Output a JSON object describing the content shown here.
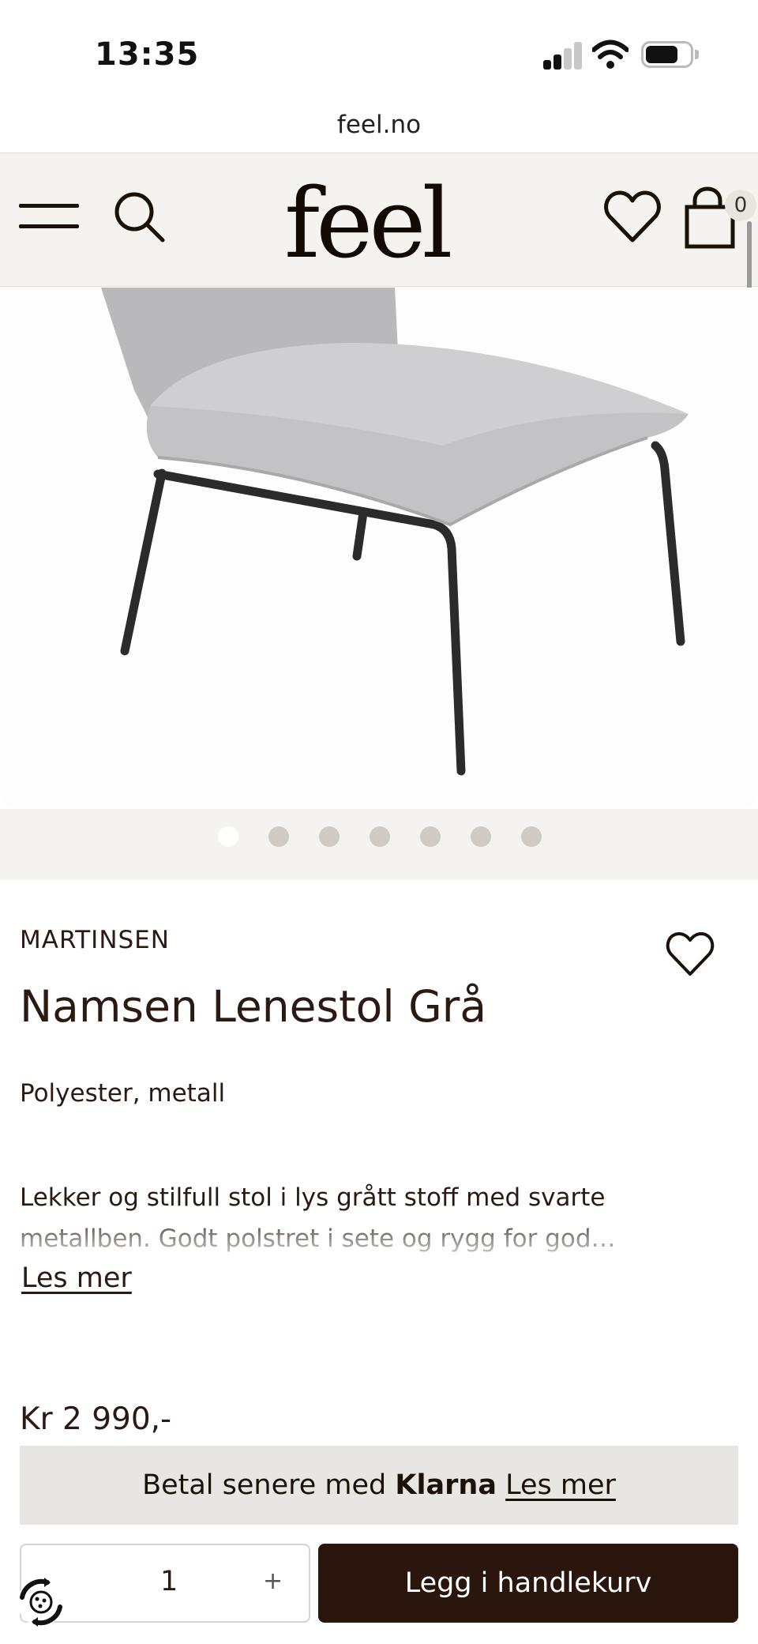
{
  "status_bar": {
    "time": "13:35"
  },
  "browser": {
    "url": "feel.no"
  },
  "header": {
    "logo": "feel",
    "cart_count": "0"
  },
  "carousel": {
    "total": 7,
    "active_index": 0
  },
  "product": {
    "brand": "MARTINSEN",
    "title": "Namsen Lenestol Grå",
    "material": "Polyester, metall",
    "description": "Lekker og stilfull stol i lys grått stoff med svarte metallben. Godt polstret i sete og rygg for god…",
    "read_more_label": "Les mer",
    "price": "Kr 2 990,-"
  },
  "klarna": {
    "text": "Betal senere med",
    "brand": "Klarna",
    "link_label": "Les mer"
  },
  "quantity": {
    "value": "1",
    "plus_label": "+"
  },
  "cart_button": {
    "label": "Legg i handlekurv"
  },
  "colors": {
    "accent": "#2b160d",
    "header_bg": "#f5f3f0",
    "klarna_bg": "#e8e6e2"
  }
}
